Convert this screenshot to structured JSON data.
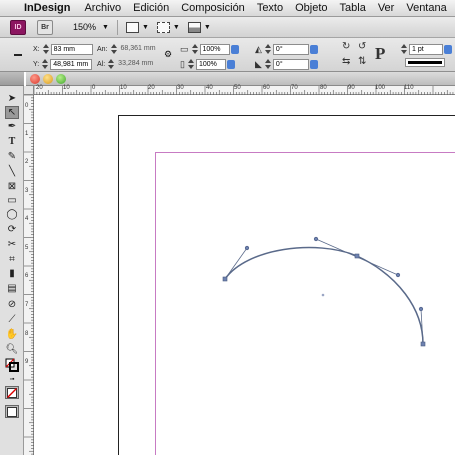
{
  "menubar": {
    "app": "InDesign",
    "items": [
      "Archivo",
      "Edición",
      "Composición",
      "Texto",
      "Objeto",
      "Tabla",
      "Ver",
      "Ventana"
    ]
  },
  "appbar": {
    "id_logo": "ID",
    "br_logo": "Br",
    "zoom": "150%"
  },
  "control": {
    "x_label": "X:",
    "x_value": "83 mm",
    "y_label": "Y:",
    "y_value": "48,981 mm",
    "w_label": "An:",
    "w_value": "68,361 mm",
    "h_label": "Al:",
    "h_value": "33,284 mm",
    "scale_x": "100%",
    "scale_y": "100%",
    "angle": "0°",
    "shear": "0°",
    "stroke_weight": "1 pt"
  },
  "ruler": {
    "h_labels": [
      "20",
      "10",
      "0",
      "10",
      "20",
      "30",
      "40",
      "50",
      "60",
      "70",
      "80",
      "90",
      "100",
      "110"
    ],
    "v_labels": [
      "0",
      "1",
      "2",
      "3",
      "4",
      "5",
      "6",
      "7",
      "8",
      "9"
    ]
  },
  "colors": {
    "accent": "#4a7fd6",
    "margin_guide": "#c77bc3",
    "path": "#5a6a8a",
    "app_logo": "#8c1660"
  },
  "icons": [
    "apple-icon",
    "selection-tool-icon",
    "direct-selection-tool-icon",
    "pen-tool-icon",
    "type-tool-icon",
    "pencil-tool-icon",
    "line-tool-icon",
    "rectangle-frame-tool-icon",
    "rectangle-tool-icon",
    "ellipse-tool-icon",
    "rotate-tool-icon",
    "scissors-tool-icon",
    "free-transform-tool-icon",
    "gradient-swatch-tool-icon",
    "note-tool-icon",
    "eyedropper-tool-icon",
    "hand-tool-icon",
    "zoom-tool-icon",
    "fill-stroke-icon",
    "apply-none-icon",
    "screen-mode-icon"
  ]
}
